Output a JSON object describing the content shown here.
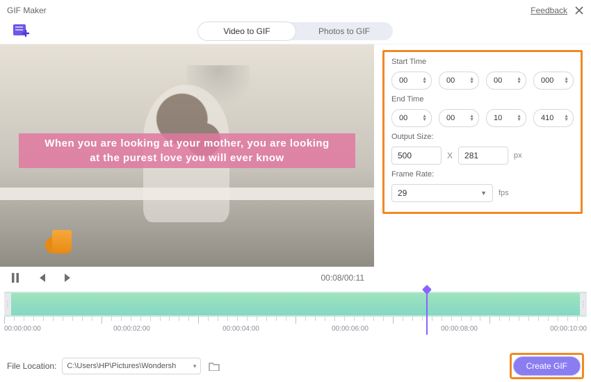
{
  "window": {
    "title": "GIF Maker",
    "feedback_label": "Feedback"
  },
  "tabs": {
    "video": "Video to GIF",
    "photos": "Photos to GIF",
    "active": "video"
  },
  "subtitle": {
    "line1": "When you are looking at your mother, you are looking",
    "line2": "at the purest love you will ever know"
  },
  "playback": {
    "current": "00:08",
    "total": "00:11"
  },
  "settings": {
    "start_label": "Start Time",
    "end_label": "End Time",
    "size_label": "Output Size:",
    "fps_label": "Frame Rate:",
    "start": {
      "hh": "00",
      "mm": "00",
      "ss": "00",
      "ms": "000"
    },
    "end": {
      "hh": "00",
      "mm": "00",
      "ss": "10",
      "ms": "410"
    },
    "size": {
      "w": "500",
      "x": "X",
      "h": "281",
      "unit": "px"
    },
    "fps": {
      "value": "29",
      "unit": "fps"
    }
  },
  "timeline_labels": [
    "00:00:00:00",
    "00:00:02:00",
    "00:00:04:00",
    "00:00:06:00",
    "00:00:08:00",
    "00:00:10:00"
  ],
  "footer": {
    "file_location_label": "File Location:",
    "path": "C:\\Users\\HP\\Pictures\\Wondersh",
    "create_label": "Create GIF"
  },
  "icons": {
    "logo": "wondershare-plus-logo",
    "close": "close-icon",
    "pause": "pause-icon",
    "prev": "prev-frame-icon",
    "next": "next-frame-icon",
    "folder": "folder-icon"
  },
  "colors": {
    "accent": "#8a7df2",
    "highlight": "#f08a24",
    "timeline": "#83d8c4"
  }
}
